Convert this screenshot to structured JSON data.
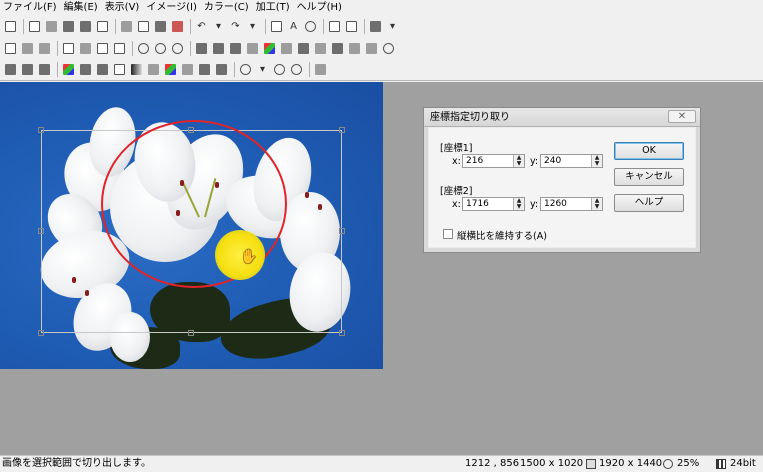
{
  "menu": [
    "ファイル(F)",
    "編集(E)",
    "表示(V)",
    "イメージ(I)",
    "カラー(C)",
    "加工(T)",
    "ヘルプ(H)"
  ],
  "dialog": {
    "title": "座標指定切り取り",
    "close_glyph": "✕",
    "group1": "[座標1]",
    "group2": "[座標2]",
    "x_label": "x:",
    "y_label": "y:",
    "x1": "216",
    "y1": "240",
    "x2": "1716",
    "y2": "1260",
    "ok": "OK",
    "cancel": "キャンセル",
    "help": "ヘルプ",
    "keep_ratio": "縦横比を維持する(A)",
    "keep_ratio_checked": false
  },
  "status": {
    "message": "画像を選択範囲で切り出します。",
    "cursor": "1212 , 856",
    "selection": "1500 x 1020",
    "image_size": "1920 x 1440",
    "zoom": "25%",
    "depth": "24bit"
  },
  "colors": {
    "sky": "#1f5cb4",
    "highlight_circle": "#e0242a",
    "cursor_spot": "#f5df10",
    "ok_border": "#3c7fb1"
  }
}
